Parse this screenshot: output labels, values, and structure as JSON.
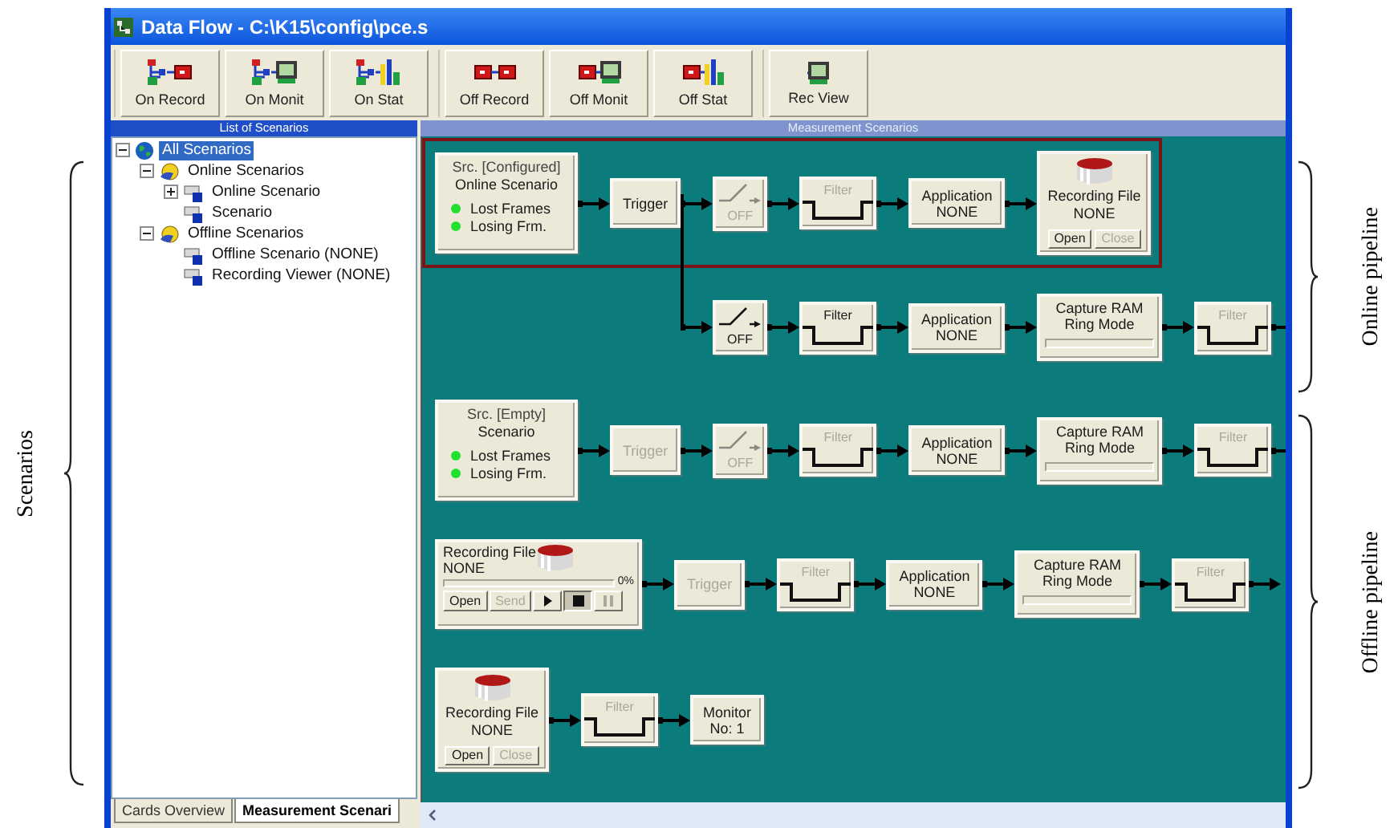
{
  "annotations": {
    "scenarios": "Scenarios",
    "online_pipeline": "Online pipeline",
    "offline_pipeline": "Offline pipeline"
  },
  "window": {
    "title": "Data Flow - C:\\K15\\config\\pce.s"
  },
  "toolbar_groups": [
    {
      "buttons": [
        {
          "label": "On Record",
          "kind": "online-record"
        },
        {
          "label": "On Monit",
          "kind": "online-monitor"
        },
        {
          "label": "On Stat",
          "kind": "online-stats"
        }
      ]
    },
    {
      "buttons": [
        {
          "label": "Off Record",
          "kind": "offline-record"
        },
        {
          "label": "Off Monit",
          "kind": "offline-monitor"
        },
        {
          "label": "Off Stat",
          "kind": "offline-stats"
        }
      ]
    },
    {
      "buttons": [
        {
          "label": "Rec View",
          "kind": "monitor"
        }
      ]
    }
  ],
  "scenario_list": {
    "title": "List of Scenarios",
    "tree": [
      {
        "label": "All Scenarios",
        "kind": "root",
        "selected": true,
        "expanded": true,
        "children": [
          {
            "label": "Online Scenarios",
            "kind": "folder",
            "selected": false,
            "expanded": true,
            "children": [
              {
                "label": "Online Scenario",
                "kind": "scenario",
                "selected": false,
                "expanded": false
              },
              {
                "label": "Scenario",
                "kind": "scenario",
                "selected": false
              }
            ]
          },
          {
            "label": "Offline Scenarios",
            "kind": "folder",
            "selected": false,
            "expanded": true,
            "children": [
              {
                "label": "Offline Scenario (NONE)",
                "kind": "scenario",
                "selected": false
              },
              {
                "label": "Recording Viewer (NONE)",
                "kind": "scenario",
                "selected": false
              }
            ]
          }
        ]
      }
    ]
  },
  "bottom_tabs": [
    {
      "label": "Cards Overview",
      "selected": false
    },
    {
      "label": "Measurement Scenari",
      "selected": true
    }
  ],
  "canvas": {
    "title": "Measurement Scenarios",
    "rows": [
      {
        "kind": "main",
        "selected": true,
        "continues": false,
        "nodes": [
          {
            "kind": "source",
            "title": "Src. [Configured]",
            "name": "Online Scenario",
            "indicators": [
              {
                "label": "Lost Frames",
                "on": true
              },
              {
                "label": "Losing Frm.",
                "on": true
              }
            ]
          },
          {
            "kind": "block",
            "lines": [
              "Trigger"
            ],
            "disabled": false
          },
          {
            "kind": "switch",
            "label": "OFF",
            "disabled": true
          },
          {
            "kind": "filter",
            "label": "Filter",
            "disabled": true
          },
          {
            "kind": "block",
            "lines": [
              "Application",
              "NONE"
            ],
            "disabled": false
          },
          {
            "kind": "recording",
            "lines": [
              "Recording File",
              "NONE"
            ],
            "buttons": [
              {
                "label": "Open",
                "disabled": false
              },
              {
                "label": "Close",
                "disabled": true
              }
            ]
          }
        ]
      },
      {
        "kind": "branch",
        "selected": false,
        "continues": true,
        "nodes": [
          {
            "kind": "switch",
            "label": "OFF",
            "disabled": false
          },
          {
            "kind": "filter",
            "label": "Filter",
            "disabled": false
          },
          {
            "kind": "block",
            "lines": [
              "Application",
              "NONE"
            ],
            "disabled": false
          },
          {
            "kind": "capture",
            "lines": [
              "Capture RAM",
              "Ring Mode"
            ],
            "level": 0
          },
          {
            "kind": "filter",
            "label": "Filter",
            "disabled": true
          }
        ]
      },
      {
        "kind": "main",
        "selected": false,
        "continues": true,
        "nodes": [
          {
            "kind": "source",
            "title": "Src. [Empty]",
            "name": "Scenario",
            "indicators": [
              {
                "label": "Lost Frames",
                "on": true
              },
              {
                "label": "Losing Frm.",
                "on": true
              }
            ]
          },
          {
            "kind": "block",
            "lines": [
              "Trigger"
            ],
            "disabled": true
          },
          {
            "kind": "switch",
            "label": "OFF",
            "disabled": true
          },
          {
            "kind": "filter",
            "label": "Filter",
            "disabled": true
          },
          {
            "kind": "block",
            "lines": [
              "Application",
              "NONE"
            ],
            "disabled": false
          },
          {
            "kind": "capture",
            "lines": [
              "Capture RAM",
              "Ring Mode"
            ],
            "level": 0
          },
          {
            "kind": "filter",
            "label": "Filter",
            "disabled": true
          }
        ]
      },
      {
        "kind": "main",
        "selected": false,
        "continues": true,
        "nodes": [
          {
            "kind": "player",
            "lines": [
              "Recording File",
              "NONE"
            ],
            "reading": "0%",
            "level": 0,
            "buttons": [
              {
                "kind": "text",
                "label": "Open",
                "disabled": false,
                "pressed": false
              },
              {
                "kind": "text",
                "label": "Send",
                "disabled": true,
                "pressed": false
              },
              {
                "kind": "play",
                "disabled": false,
                "pressed": false
              },
              {
                "kind": "stop",
                "disabled": false,
                "pressed": true
              },
              {
                "kind": "pause",
                "disabled": true,
                "pressed": false
              }
            ]
          },
          {
            "kind": "block",
            "lines": [
              "Trigger"
            ],
            "disabled": true
          },
          {
            "kind": "filter",
            "label": "Filter",
            "disabled": true
          },
          {
            "kind": "block",
            "lines": [
              "Application",
              "NONE"
            ],
            "disabled": false
          },
          {
            "kind": "capture",
            "lines": [
              "Capture RAM",
              "Ring Mode"
            ],
            "level": 0
          },
          {
            "kind": "filter",
            "label": "Filter",
            "disabled": true
          }
        ]
      },
      {
        "kind": "main",
        "selected": false,
        "continues": false,
        "nodes": [
          {
            "kind": "recording",
            "lines": [
              "Recording File",
              "NONE"
            ],
            "buttons": [
              {
                "label": "Open",
                "disabled": false
              },
              {
                "label": "Close",
                "disabled": true
              }
            ]
          },
          {
            "kind": "filter",
            "label": "Filter",
            "disabled": true
          },
          {
            "kind": "block",
            "lines": [
              "Monitor",
              "No: 1"
            ],
            "disabled": false
          }
        ]
      }
    ]
  }
}
